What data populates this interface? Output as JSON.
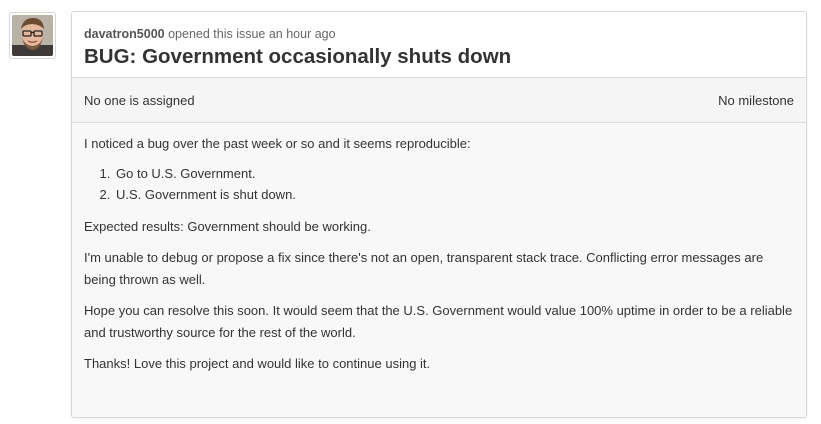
{
  "issue": {
    "author": "davatron5000",
    "opened_text": "opened this issue an hour ago",
    "title": "BUG: Government occasionally shuts down",
    "assignee_text": "No one is assigned",
    "milestone_text": "No milestone",
    "body": {
      "intro": "I noticed a bug over the past week or so and it seems reproducible:",
      "steps": [
        "Go to U.S. Government.",
        "U.S. Government is shut down."
      ],
      "expected": "Expected results: Government should be working.",
      "debug": "I'm unable to debug or propose a fix since there's not an open, transparent stack trace. Conflicting error messages are being thrown as well.",
      "hope": "Hope you can resolve this soon. It would seem that the U.S. Government would value 100% uptime in order to be a reliable and trustworthy source for the rest of the world.",
      "thanks": "Thanks! Love this project and would like to continue using it."
    }
  },
  "icons": {
    "avatar": "user-avatar-photo"
  },
  "colors": {
    "border": "#d6d6d6",
    "panel_bg": "#f8f8f8",
    "text": "#333333",
    "meta_text": "#666666"
  }
}
